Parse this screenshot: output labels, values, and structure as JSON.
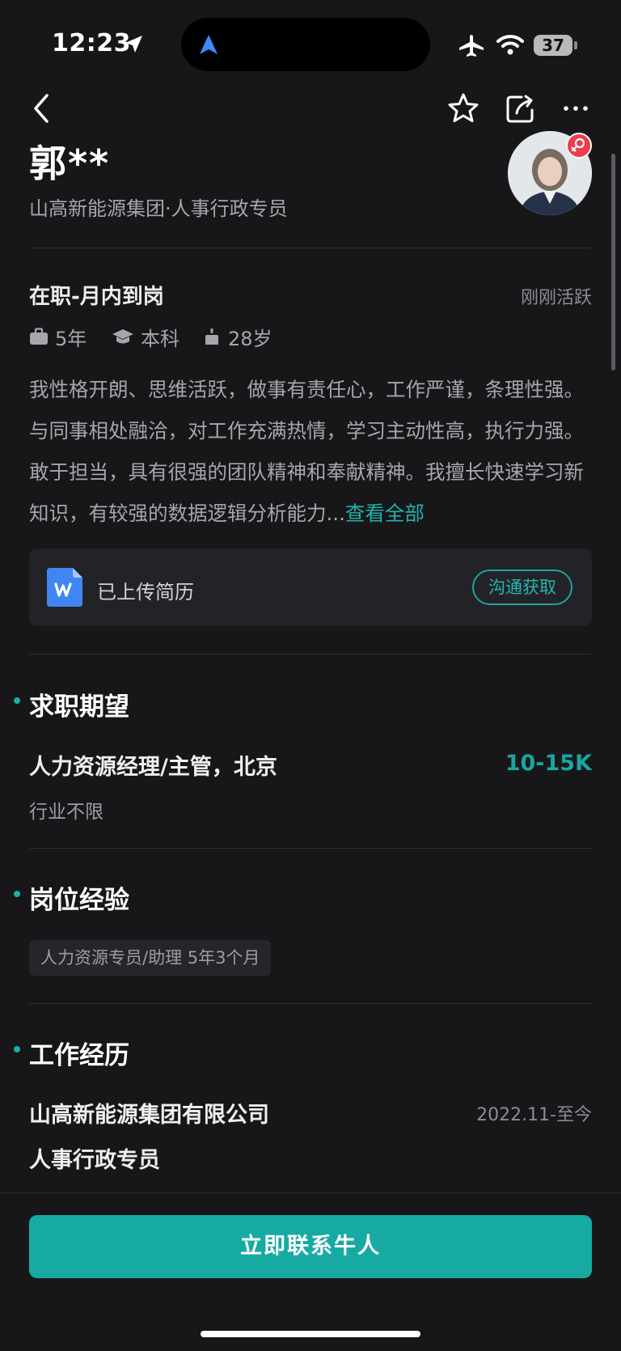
{
  "status_bar": {
    "time": "12:23",
    "battery": "37"
  },
  "profile": {
    "name": "郭**",
    "subtitle": "山高新能源集团·人事行政专员",
    "job_status": "在职-月内到岗",
    "active_status": "刚刚活跃",
    "experience_years": "5年",
    "education": "本科",
    "age": "28岁",
    "intro_text": "我性格开朗、思维活跃，做事有责任心，工作严谨，条理性强。与同事相处融洽，对工作充满热情，学习主动性高，执行力强。敢于担当，具有很强的团队精神和奉献精神。我擅长快速学习新知识，有较强的数据逻辑分析能力...",
    "intro_more": "查看全部"
  },
  "resume": {
    "label": "已上传简历",
    "action": "沟通获取"
  },
  "expectation": {
    "section_title": "求职期望",
    "title": "人力资源经理/主管，北京",
    "salary": "10-15K",
    "industry": "行业不限"
  },
  "position_experience": {
    "section_title": "岗位经验",
    "tag": "人力资源专员/助理 5年3个月"
  },
  "work_history": {
    "section_title": "工作经历",
    "company": "山高新能源集团有限公司",
    "period": "2022.11-至今",
    "position": "人事行政专员"
  },
  "cta": {
    "label": "立即联系牛人"
  },
  "colors": {
    "accent": "#17aaa3",
    "background": "#17171a",
    "gender_badge": "#ee3d4a"
  }
}
